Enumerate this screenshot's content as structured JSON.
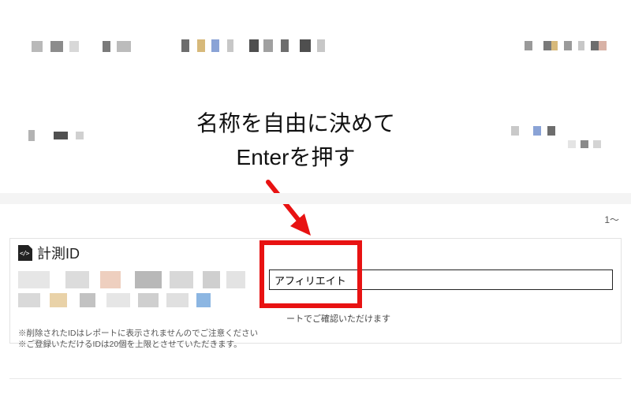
{
  "annotation": {
    "line1": "名称を自由に決めて",
    "line2": "Enterを押す"
  },
  "pager": {
    "text": "1～"
  },
  "panel": {
    "title": "計測ID",
    "input_value": "アフィリエイト",
    "sub_hint": "ートでご確認いただけます",
    "note1": "※削除されたIDはレポートに表示されませんのでご注意ください",
    "note2": "※ご登録いただけるIDは20個を上限とさせていただきます。"
  },
  "colors": {
    "red": "#e81212"
  }
}
